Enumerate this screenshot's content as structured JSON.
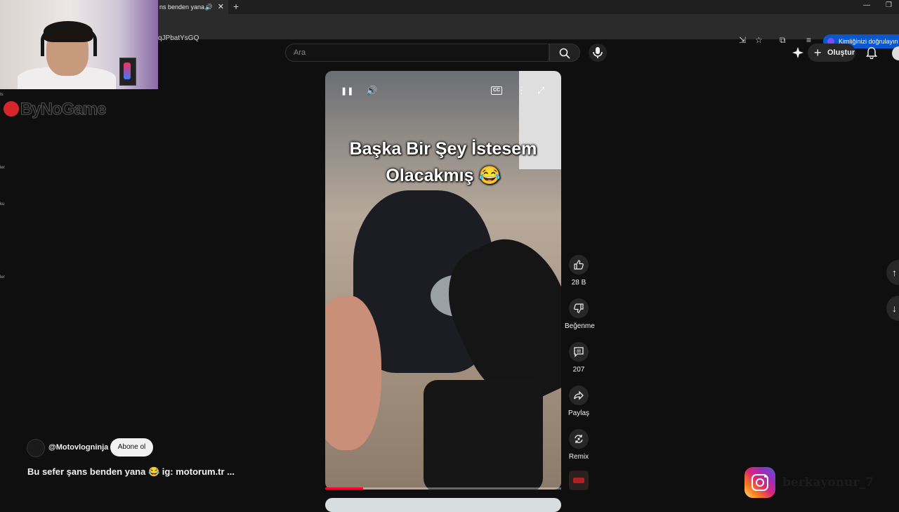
{
  "browser": {
    "tab_title": "ns benden yana",
    "sound_icon": "🔊",
    "close_icon": "✕",
    "new_tab_icon": "+",
    "url": "qJPbatYsGQ",
    "profile_button": "Kimliğinizi doğrulayın",
    "colors": {
      "profile_accent": "#0b57d0"
    }
  },
  "overlay": {
    "logo_text": "ByNoGame",
    "instagram_handle": "berkayonur_7",
    "sidebar_fragments": [
      "ts",
      "ler",
      "ku",
      "ler"
    ]
  },
  "header": {
    "search_placeholder": "Ara",
    "create_label": "Oluştur",
    "create_icon": "+"
  },
  "video": {
    "caption_line1": "Başka Bir Şey İstesem",
    "caption_line2": "Olacakmış 😂",
    "progress": 0.16,
    "controls": {
      "pause_icon": "❚❚",
      "volume_icon": "🔊",
      "cc_label": "CC",
      "more_icon": "⋮",
      "fullscreen_icon": "⤢"
    }
  },
  "actions": {
    "like_count": "28 B",
    "dislike_label": "Beğenme",
    "comment_count": "207",
    "share_label": "Paylaş",
    "remix_label": "Remix"
  },
  "channel": {
    "name": "@Motovlogninja",
    "subscribe_label": "Abone ol",
    "video_title": "Bu sefer şans benden yana 😂 ig: motorum.tr ..."
  },
  "nav": {
    "up_icon": "↑",
    "down_icon": "↓"
  }
}
